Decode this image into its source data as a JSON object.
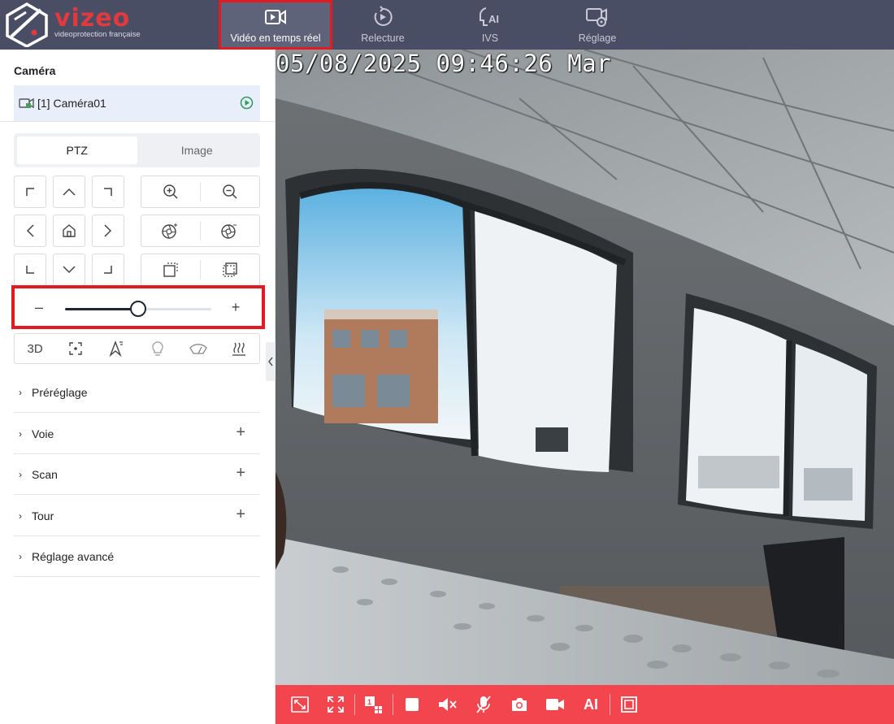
{
  "brand": {
    "name": "vizeo",
    "tagline": "videoprotection française",
    "accent": "#e21b22",
    "topbar_color": "#4a4e64",
    "toolbar_color": "#f2454d"
  },
  "nav": {
    "items": [
      {
        "label": "Vidéo en temps réel",
        "icon": "live-video-icon",
        "active": true
      },
      {
        "label": "Relecture",
        "icon": "playback-icon"
      },
      {
        "label": "IVS",
        "icon": "ai-icon"
      },
      {
        "label": "Réglage",
        "icon": "settings-camera-icon"
      }
    ]
  },
  "sidebar": {
    "camera_title": "Caméra",
    "camera_item": "[1] Caméra01",
    "tabs": [
      "PTZ",
      "Image"
    ],
    "active_tab": "PTZ",
    "ptz_slider": {
      "value": 0.5,
      "minus": "–",
      "plus": "+"
    },
    "tool_3d_label": "3D",
    "sections": [
      {
        "label": "Préréglage",
        "has_add": false
      },
      {
        "label": "Voie",
        "has_add": true
      },
      {
        "label": "Scan",
        "has_add": true
      },
      {
        "label": "Tour",
        "has_add": true
      },
      {
        "label": "Réglage avancé",
        "has_add": false
      }
    ],
    "add_symbol": "+",
    "chevron": "›"
  },
  "video": {
    "osd_text": "05/08/2025 09:46:26 Mar"
  },
  "toolbar": {
    "ai_label": "AI"
  }
}
